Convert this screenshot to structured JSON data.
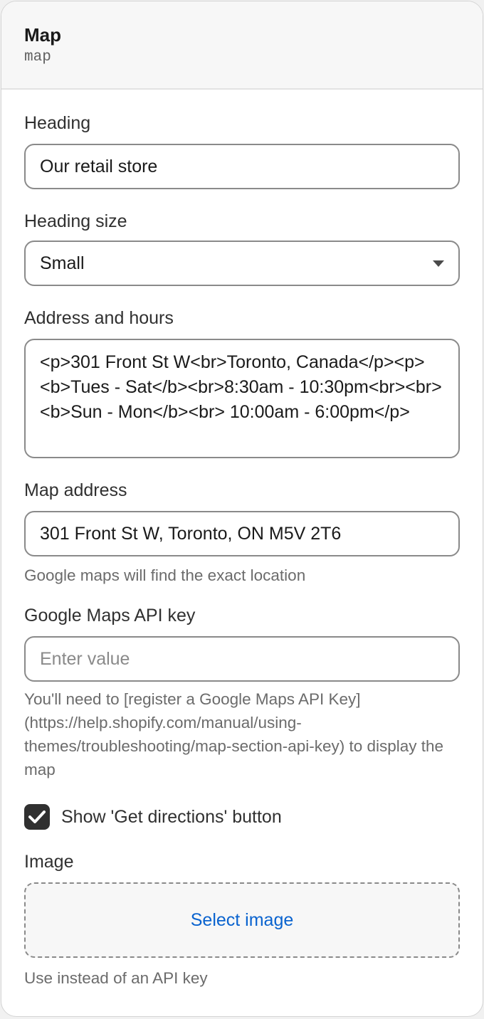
{
  "header": {
    "title": "Map",
    "subtitle": "map"
  },
  "fields": {
    "heading": {
      "label": "Heading",
      "value": "Our retail store"
    },
    "heading_size": {
      "label": "Heading size",
      "value": "Small"
    },
    "address_hours": {
      "label": "Address and hours",
      "value": "<p>301 Front St W<br>Toronto, Canada</p><p><b>Tues - Sat</b><br>8:30am - 10:30pm<br><br><b>Sun - Mon</b><br> 10:00am - 6:00pm</p>"
    },
    "map_address": {
      "label": "Map address",
      "value": "301 Front St W, Toronto, ON M5V 2T6",
      "help": "Google maps will find the exact location"
    },
    "api_key": {
      "label": "Google Maps API key",
      "placeholder": "Enter value",
      "help": "You'll need to [register a Google Maps API Key](https://help.shopify.com/manual/using-themes/troubleshooting/map-section-api-key) to display the map"
    },
    "show_directions": {
      "label": "Show 'Get directions' button",
      "checked": true
    },
    "image": {
      "label": "Image",
      "button_label": "Select image",
      "help": "Use instead of an API key"
    }
  },
  "icons": {
    "dropdown": "chevron-down-icon",
    "checkbox": "checkmark-icon"
  },
  "colors": {
    "link": "#0a63cf",
    "checkbox_fill": "#303030",
    "border": "#8a8a8a"
  }
}
